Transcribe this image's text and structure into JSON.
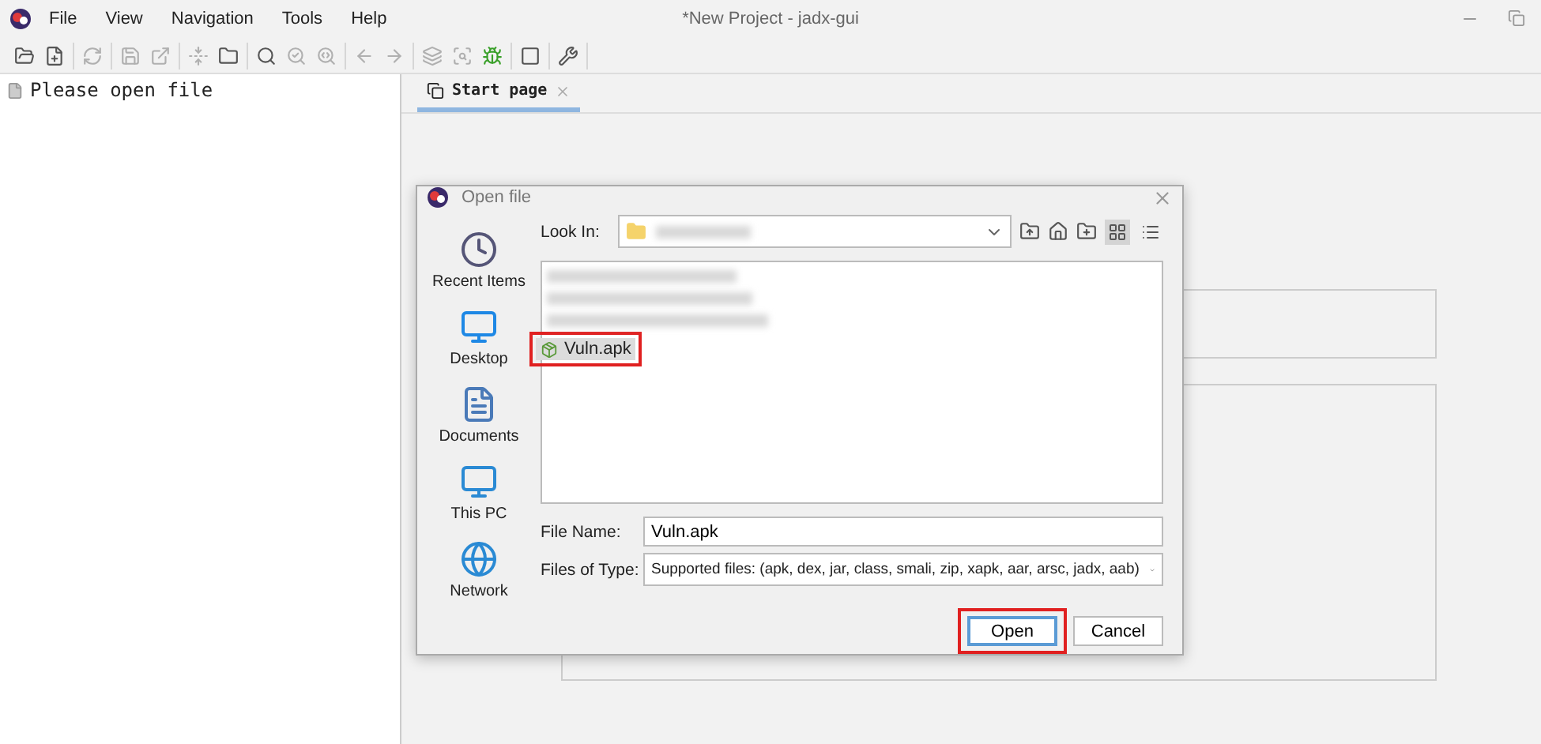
{
  "window": {
    "title": "*New Project - jadx-gui"
  },
  "menu": [
    "File",
    "View",
    "Navigation",
    "Tools",
    "Help"
  ],
  "toolbar": [
    [
      {
        "kind": "open",
        "disabled": false
      },
      {
        "kind": "add-file",
        "disabled": false
      }
    ],
    [
      {
        "kind": "reload",
        "disabled": true
      }
    ],
    [
      {
        "kind": "save",
        "disabled": true
      },
      {
        "kind": "export",
        "disabled": true
      }
    ],
    [
      {
        "kind": "sync",
        "disabled": true
      },
      {
        "kind": "flatten",
        "disabled": false
      }
    ],
    [
      {
        "kind": "search",
        "disabled": false
      },
      {
        "kind": "find-class",
        "disabled": true
      },
      {
        "kind": "find-usage",
        "disabled": true
      }
    ],
    [
      {
        "kind": "back",
        "disabled": true
      },
      {
        "kind": "forward",
        "disabled": true
      }
    ],
    [
      {
        "kind": "deobf",
        "disabled": true
      },
      {
        "kind": "quark",
        "disabled": true
      },
      {
        "kind": "debug",
        "disabled": false
      }
    ],
    [
      {
        "kind": "log",
        "disabled": false
      }
    ],
    [
      {
        "kind": "prefs",
        "disabled": false
      }
    ]
  ],
  "tree": {
    "placeholder": "Please open file"
  },
  "tabs": [
    {
      "label": "Start page",
      "selected": true
    }
  ],
  "dialog": {
    "title": "Open file",
    "places": [
      {
        "kind": "recent",
        "label": "Recent Items"
      },
      {
        "kind": "desktop",
        "label": "Desktop"
      },
      {
        "kind": "documents",
        "label": "Documents"
      },
      {
        "kind": "pc",
        "label": "This PC"
      },
      {
        "kind": "network",
        "label": "Network"
      }
    ],
    "look_in_label": "Look In:",
    "view_buttons": [
      {
        "kind": "grid",
        "selected": true
      },
      {
        "kind": "details",
        "selected": false
      }
    ],
    "files": [
      {
        "kind": "blurred",
        "selected": false
      },
      {
        "kind": "blurred",
        "selected": false
      },
      {
        "kind": "blurred",
        "selected": false
      },
      {
        "kind": "apk",
        "name": "Vuln.apk",
        "selected": true
      }
    ],
    "file_name_label": "File Name:",
    "file_name": "Vuln.apk",
    "file_type_label": "Files of Type:",
    "file_type": "Supported files: (apk, dex, jar, class, smali, zip, xapk, aar, arsc, jadx, aab)",
    "buttons": [
      {
        "label": "Open",
        "default": true
      },
      {
        "label": "Cancel",
        "default": false
      }
    ]
  }
}
